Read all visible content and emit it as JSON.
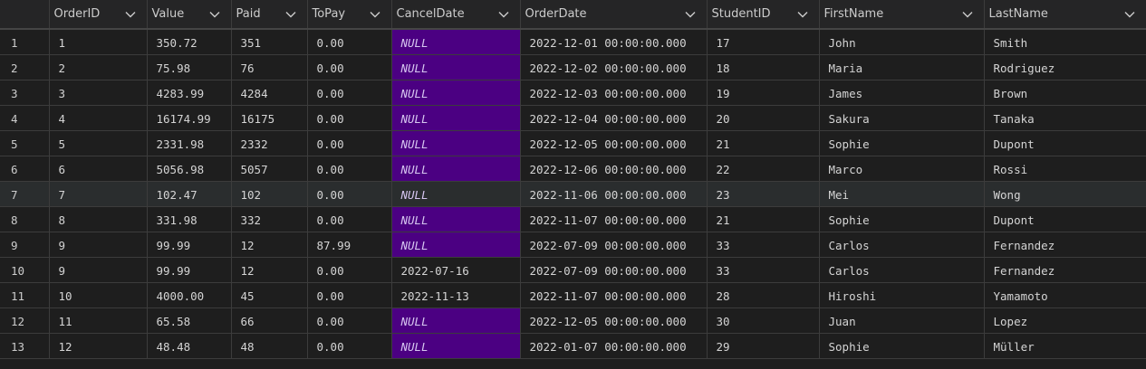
{
  "columns": [
    "",
    "OrderID",
    "Value",
    "Paid",
    "ToPay",
    "CancelDate",
    "OrderDate",
    "StudentID",
    "FirstName",
    "LastName"
  ],
  "null_label": "NULL",
  "colors": {
    "background": "#1e1e1e",
    "header": "#252526",
    "null_cell": "#4b0082",
    "selected_row": "#2a2d2e"
  },
  "selected_row_index": 6,
  "rows": [
    [
      "1",
      "1",
      "350.72",
      "351",
      "0.00",
      "NULL",
      "2022-12-01 00:00:00.000",
      "17",
      "John",
      "Smith"
    ],
    [
      "2",
      "2",
      "75.98",
      "76",
      "0.00",
      "NULL",
      "2022-12-02 00:00:00.000",
      "18",
      "Maria",
      "Rodriguez"
    ],
    [
      "3",
      "3",
      "4283.99",
      "4284",
      "0.00",
      "NULL",
      "2022-12-03 00:00:00.000",
      "19",
      "James",
      "Brown"
    ],
    [
      "4",
      "4",
      "16174.99",
      "16175",
      "0.00",
      "NULL",
      "2022-12-04 00:00:00.000",
      "20",
      "Sakura",
      "Tanaka"
    ],
    [
      "5",
      "5",
      "2331.98",
      "2332",
      "0.00",
      "NULL",
      "2022-12-05 00:00:00.000",
      "21",
      "Sophie",
      "Dupont"
    ],
    [
      "6",
      "6",
      "5056.98",
      "5057",
      "0.00",
      "NULL",
      "2022-12-06 00:00:00.000",
      "22",
      "Marco",
      "Rossi"
    ],
    [
      "7",
      "7",
      "102.47",
      "102",
      "0.00",
      "NULL",
      "2022-11-06 00:00:00.000",
      "23",
      "Mei",
      "Wong"
    ],
    [
      "8",
      "8",
      "331.98",
      "332",
      "0.00",
      "NULL",
      "2022-11-07 00:00:00.000",
      "21",
      "Sophie",
      "Dupont"
    ],
    [
      "9",
      "9",
      "99.99",
      "12",
      "87.99",
      "NULL",
      "2022-07-09 00:00:00.000",
      "33",
      "Carlos",
      "Fernandez"
    ],
    [
      "10",
      "9",
      "99.99",
      "12",
      "0.00",
      "2022-07-16",
      "2022-07-09 00:00:00.000",
      "33",
      "Carlos",
      "Fernandez"
    ],
    [
      "11",
      "10",
      "4000.00",
      "45",
      "0.00",
      "2022-11-13",
      "2022-11-07 00:00:00.000",
      "28",
      "Hiroshi",
      "Yamamoto"
    ],
    [
      "12",
      "11",
      "65.58",
      "66",
      "0.00",
      "NULL",
      "2022-12-05 00:00:00.000",
      "30",
      "Juan",
      "Lopez"
    ],
    [
      "13",
      "12",
      "48.48",
      "48",
      "0.00",
      "NULL",
      "2022-01-07 00:00:00.000",
      "29",
      "Sophie",
      "Müller"
    ]
  ]
}
